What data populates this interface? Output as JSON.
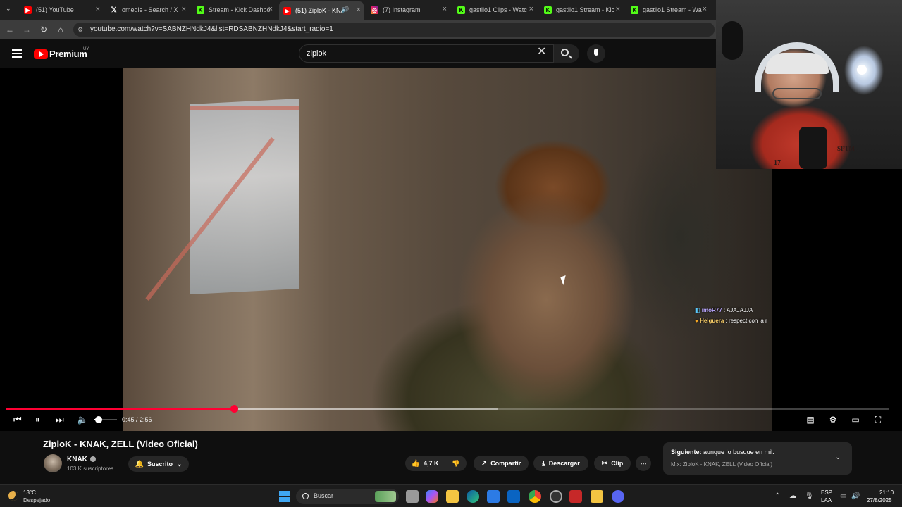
{
  "browser": {
    "tabs": [
      {
        "title": "(51) YouTube",
        "icon": "youtube-icon",
        "active": false
      },
      {
        "title": "omegle - Search / X",
        "icon": "x-icon",
        "active": false
      },
      {
        "title": "Stream - Kick Dashbo",
        "icon": "kick-icon",
        "active": false
      },
      {
        "title": "(51) ZiploK - KNA",
        "icon": "youtube-icon",
        "active": true
      },
      {
        "title": "(7) Instagram",
        "icon": "instagram-icon",
        "active": false
      },
      {
        "title": "gastilo1 Clips - Watc",
        "icon": "kick-icon",
        "active": false
      },
      {
        "title": "gastilo1 Stream - Kic",
        "icon": "kick-icon",
        "active": false
      },
      {
        "title": "gastilo1 Stream - Wa",
        "icon": "kick-icon",
        "active": false
      }
    ],
    "url": "youtube.com/watch?v=SABNZHNdkJ4&list=RDSABNZHNdkJ4&start_radio=1"
  },
  "youtube": {
    "logo_text": "Premium",
    "country_code": "UY",
    "search_value": "ziplok"
  },
  "chat": [
    {
      "user": "imoR77",
      "message": ": AJAJAJJA"
    },
    {
      "user": "Helguera",
      "message": ": respect con la r"
    }
  ],
  "player": {
    "time": "0:45 / 2:56",
    "progress_fraction": 0.258,
    "buffer_fraction": 0.557,
    "volume_fraction": 0.2
  },
  "video": {
    "title": "ZiploK - KNAK, ZELL (Video Oficial)",
    "channel": "KNAK",
    "subscribers": "103 K suscriptores",
    "subscribed_label": "Suscrito",
    "likes": "4,7 K",
    "share_label": "Compartir",
    "download_label": "Descargar",
    "clip_label": "Clip"
  },
  "up_next": {
    "label": "Siguiente:",
    "title": "aunque lo busque en mil.",
    "subtitle": "Mix: ZiploK - KNAK, ZELL (Video Oficial)"
  },
  "webcam": {
    "shirt_text": "SPTM",
    "shirt_number": "17"
  },
  "taskbar": {
    "temperature": "13°C",
    "weather": "Despejado",
    "search_label": "Buscar",
    "lang_top": "ESP",
    "lang_bottom": "LAA",
    "time": "21:10",
    "date": "27/8/2025"
  },
  "colors": {
    "youtube_red": "#ff0000",
    "progress_red": "#ff0033",
    "kick_green": "#53fc18",
    "windows_blue": "#3fa7f3"
  }
}
